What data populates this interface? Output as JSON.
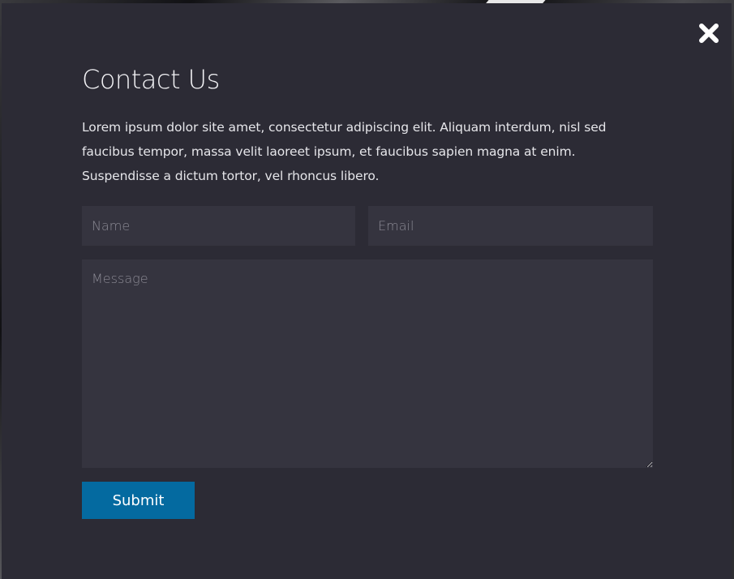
{
  "modal": {
    "title": "Contact Us",
    "intro": "Lorem ipsum dolor site amet, consectetur adipiscing elit. Aliquam interdum, nisl sed faucibus tempor, massa velit laoreet ipsum, et faucibus sapien magna at enim. Suspendisse a dictum tortor, vel rhoncus libero.",
    "close_icon": "close-icon"
  },
  "form": {
    "name": {
      "placeholder": "Name",
      "value": ""
    },
    "email": {
      "placeholder": "Email",
      "value": ""
    },
    "message": {
      "placeholder": "Message",
      "value": ""
    },
    "submit_label": "Submit"
  },
  "colors": {
    "modal_background": "#2c2b35",
    "field_background": "#35343f",
    "submit_background": "#046aa0",
    "text": "#f2f2f5"
  }
}
